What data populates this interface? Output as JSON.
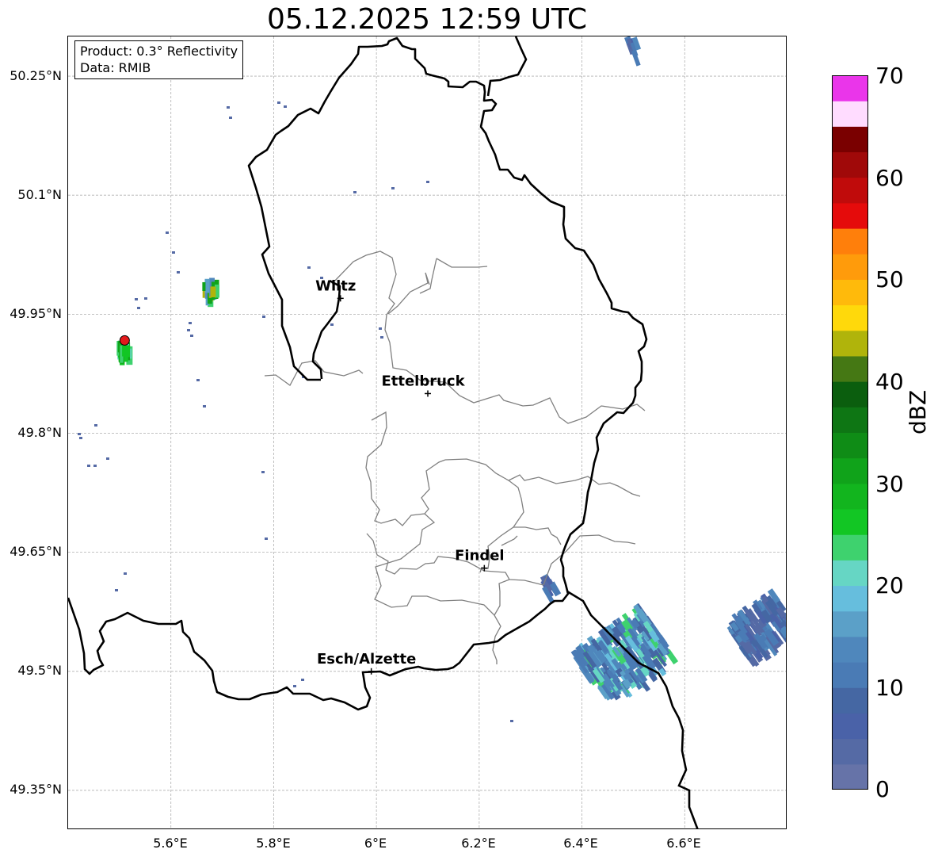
{
  "title": "05.12.2025 12:59 UTC",
  "info": {
    "product": "Product: 0.3° Reflectivity",
    "data": "Data: RMIB"
  },
  "lat_labels": [
    "50.25°N",
    "50.1°N",
    "49.95°N",
    "49.8°N",
    "49.65°N",
    "49.5°N",
    "49.35°N"
  ],
  "lon_labels": [
    "5.6°E",
    "5.8°E",
    "6°E",
    "6.2°E",
    "6.4°E",
    "6.6°E"
  ],
  "extent": {
    "lon_min": 5.4,
    "lon_max": 6.8,
    "lat_min": 49.3,
    "lat_max": 50.3
  },
  "cities": [
    {
      "name": "Wiltz",
      "lon": 5.93,
      "lat": 49.97
    },
    {
      "name": "Ettelbruck",
      "lon": 6.1,
      "lat": 49.85
    },
    {
      "name": "Findel",
      "lon": 6.21,
      "lat": 49.63
    },
    {
      "name": "Esch/Alzette",
      "lon": 5.99,
      "lat": 49.5
    }
  ],
  "radar_site": {
    "lon": 5.51,
    "lat": 49.915,
    "color": "#e41a1c"
  },
  "colorbar": {
    "unit": "dBZ",
    "ticks": [
      "0",
      "10",
      "20",
      "30",
      "40",
      "50",
      "60",
      "70"
    ],
    "min": 0,
    "max": 70,
    "step": 2.5,
    "colors": [
      "#6673a8",
      "#556aa5",
      "#4a62a8",
      "#4567a3",
      "#4a7bb5",
      "#4f87bc",
      "#5ba0c8",
      "#66bedd",
      "#66d6c4",
      "#3ed26e",
      "#12c624",
      "#12b51e",
      "#10a31a",
      "#0f8c16",
      "#0e7614",
      "#0b5e0e",
      "#457814",
      "#b0b40b",
      "#ffd90b",
      "#ffba0b",
      "#ff9b0b",
      "#ff7f0b",
      "#e50b0b",
      "#c00b0b",
      "#a00909",
      "#7a0000",
      "#ffdcff",
      "#ffb3ff",
      "#ff70ff",
      "#ea35ea"
    ]
  }
}
